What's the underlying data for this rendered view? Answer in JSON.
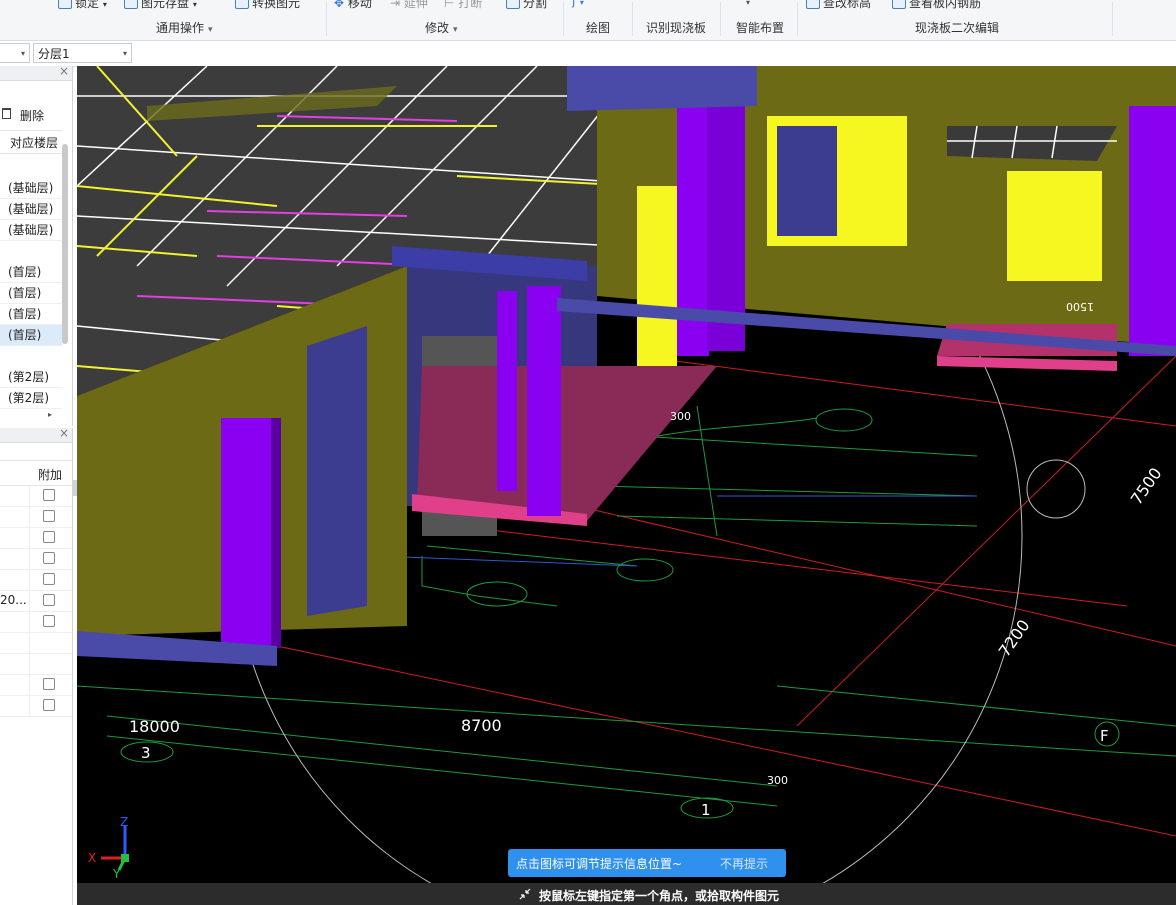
{
  "ribbon": {
    "items": [
      {
        "label": "锁定",
        "caret": "▾"
      },
      {
        "label": "图元存盘",
        "caret": "▾"
      },
      {
        "label": "转换图元"
      },
      {
        "label": "移动"
      },
      {
        "label": "延伸"
      },
      {
        "label": "打断"
      },
      {
        "label": "分割"
      },
      {
        "label": "查改标高"
      },
      {
        "label": "查看板内钢筋"
      }
    ],
    "groups": [
      {
        "label": "通用操作",
        "caret": "▾"
      },
      {
        "label": "修改",
        "caret": "▾"
      },
      {
        "label": "绘图"
      },
      {
        "label": "识别现浇板"
      },
      {
        "label": "智能布置"
      },
      {
        "label": "现浇板二次编辑"
      }
    ]
  },
  "selectors": {
    "layer": "分层1"
  },
  "floor_panel": {
    "delete_label": "删除",
    "column_header": "对应楼层",
    "rows": [
      "(基础层)",
      "(基础层)",
      "(基础层)",
      "(首层)",
      "(首层)",
      "(首层)",
      "(首层)",
      "(第2层)",
      "(第2层)"
    ],
    "selected_index": 6
  },
  "property_panel": {
    "column_header": "附加",
    "rows": [
      {
        "value": "",
        "checkbox": true
      },
      {
        "value": "",
        "checkbox": true
      },
      {
        "value": "",
        "checkbox": true
      },
      {
        "value": "",
        "checkbox": true
      },
      {
        "value": "",
        "checkbox": true
      },
      {
        "value": "20...",
        "checkbox": true
      },
      {
        "value": "",
        "checkbox": true
      },
      {
        "value": "",
        "checkbox": false
      },
      {
        "value": "",
        "checkbox": false
      },
      {
        "value": "",
        "checkbox": true
      },
      {
        "value": "",
        "checkbox": true
      }
    ]
  },
  "viewport": {
    "dimensions": [
      "18000",
      "8700",
      "7200",
      "7500",
      "1500",
      "300",
      "300"
    ],
    "axis_labels": [
      "3",
      "1",
      "F"
    ],
    "axes": {
      "x": "X",
      "y": "Y",
      "z": "Z"
    }
  },
  "tip": {
    "message": "点击图标可调节提示信息位置~",
    "dismiss": "不再提示"
  },
  "status": {
    "text": "按鼠标左键指定第一个角点，或拾取构件图元"
  }
}
